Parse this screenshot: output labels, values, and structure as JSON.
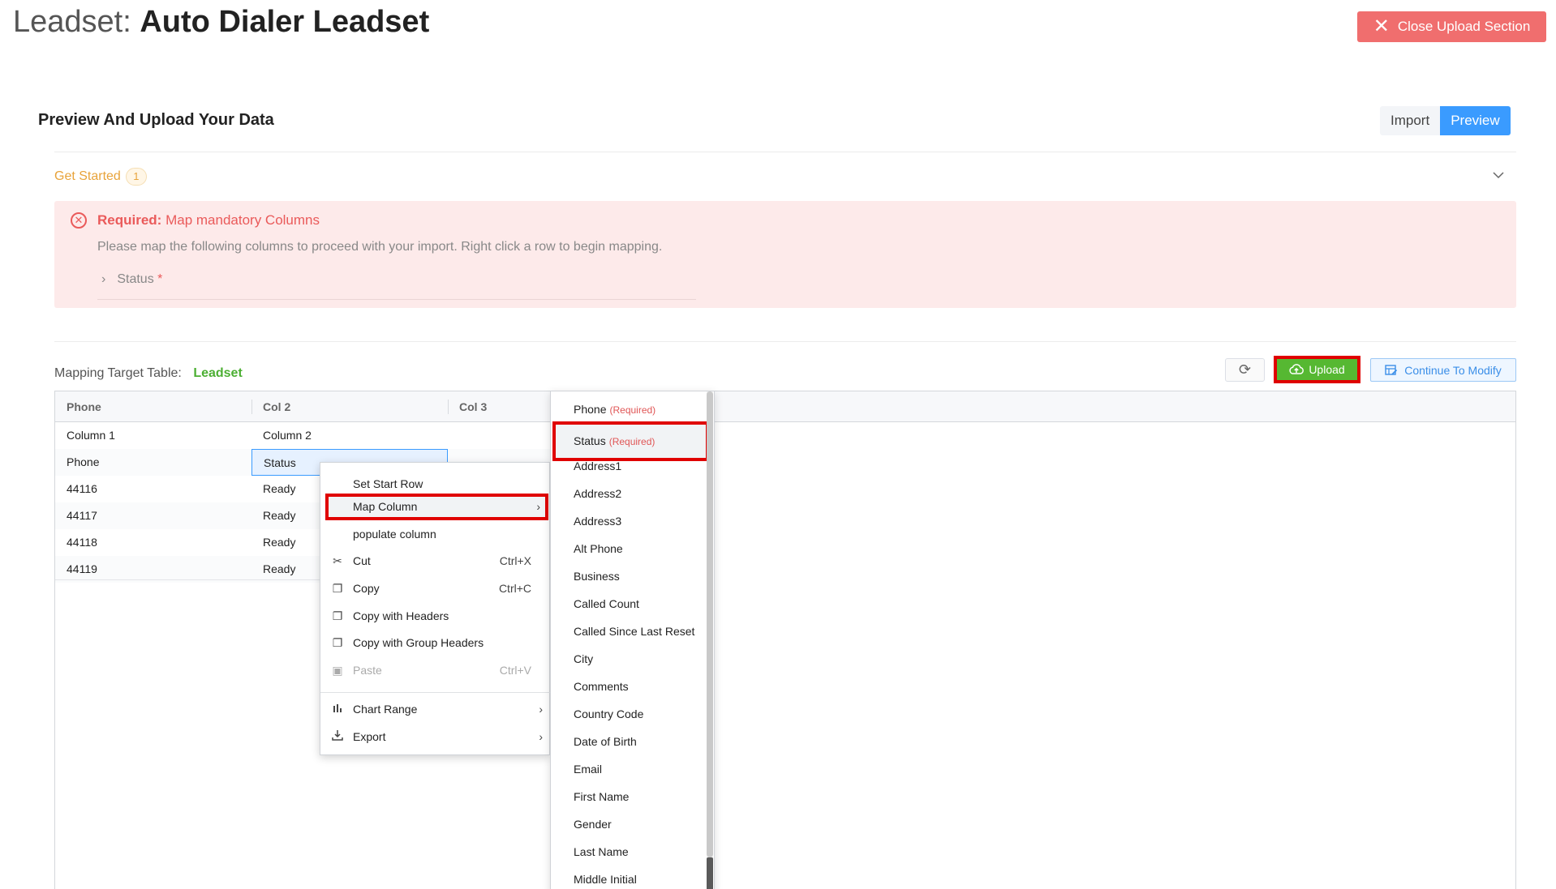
{
  "header": {
    "title_prefix": "Leadset:",
    "title_name": "Auto Dialer Leadset",
    "close_label": "Close Upload Section"
  },
  "section": {
    "title": "Preview And Upload Your Data",
    "toggle": {
      "import_label": "Import",
      "preview_label": "Preview",
      "active": "Preview"
    }
  },
  "get_started": {
    "label": "Get Started",
    "count": "1"
  },
  "alert": {
    "title_bold": "Required:",
    "title_rest": "Map mandatory Columns",
    "description": "Please map the following columns to proceed with your import. Right click a row to begin mapping.",
    "item_label": "Status",
    "item_required": "*"
  },
  "mapping": {
    "label": "Mapping Target Table:",
    "table_name": "Leadset",
    "upload_label": "Upload",
    "modify_label": "Continue To Modify"
  },
  "grid": {
    "headers": [
      "Phone",
      "Col 2",
      "Col 3"
    ],
    "rows": [
      [
        "Column 1",
        "Column 2"
      ],
      [
        "Phone",
        "Status"
      ],
      [
        "44116",
        "Ready"
      ],
      [
        "44117",
        "Ready"
      ],
      [
        "44118",
        "Ready"
      ],
      [
        "44119",
        "Ready"
      ]
    ]
  },
  "context_menu": {
    "items": [
      {
        "label": "Set Start Row",
        "icon": "",
        "shortcut": ""
      },
      {
        "label": "Map Column",
        "icon": "",
        "shortcut": "",
        "submenu": true
      },
      {
        "label": "populate column",
        "icon": "",
        "shortcut": ""
      },
      {
        "label": "Cut",
        "icon": "scissors-icon",
        "shortcut": "Ctrl+X"
      },
      {
        "label": "Copy",
        "icon": "copy-icon",
        "shortcut": "Ctrl+C"
      },
      {
        "label": "Copy with Headers",
        "icon": "copy-icon",
        "shortcut": ""
      },
      {
        "label": "Copy with Group Headers",
        "icon": "copy-icon",
        "shortcut": ""
      },
      {
        "label": "Paste",
        "icon": "clipboard-icon",
        "shortcut": "Ctrl+V",
        "disabled": true
      },
      {
        "label": "Chart Range",
        "icon": "bar-chart-icon",
        "shortcut": "",
        "submenu": true
      },
      {
        "label": "Export",
        "icon": "download-icon",
        "shortcut": "",
        "submenu": true
      }
    ]
  },
  "submenu": {
    "required_tag": "(Required)",
    "items": [
      "Phone",
      "Status",
      "Address1",
      "Address2",
      "Address3",
      "Alt Phone",
      "Business",
      "Called Count",
      "Called Since Last Reset",
      "City",
      "Comments",
      "Country Code",
      "Date of Birth",
      "Email",
      "First Name",
      "Gender",
      "Last Name",
      "Middle Initial"
    ]
  },
  "colors": {
    "close_button": "#f06e6e",
    "preview_active": "#3a9bff",
    "upload_button": "#56b832",
    "highlight_outline": "#e00000",
    "alert_bg": "#fdeaea",
    "warning": "#e8a33a"
  }
}
